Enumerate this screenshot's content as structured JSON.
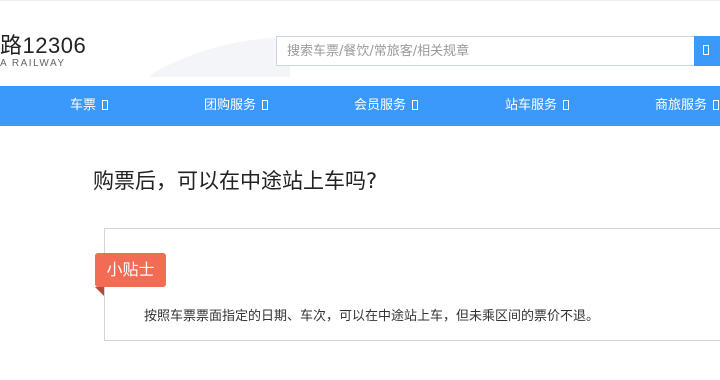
{
  "header": {
    "logo_text": "路12306",
    "logo_subtitle": "A RAILWAY",
    "search": {
      "placeholder": "搜索车票/餐饮/常旅客/相关规章",
      "button_icon": "search-icon"
    }
  },
  "nav": {
    "items": [
      {
        "label": "车票"
      },
      {
        "label": "团购服务"
      },
      {
        "label": "会员服务"
      },
      {
        "label": "站车服务"
      },
      {
        "label": "商旅服务"
      }
    ]
  },
  "content": {
    "question": "购票后，可以在中途站上车吗?",
    "tip": {
      "badge": "小贴士",
      "text": "按照车票票面指定的日期、车次，可以在中途站上车，但未乘区间的票价不退。"
    }
  },
  "colors": {
    "nav_bg": "#3b99fc",
    "badge_bg": "#f26b55"
  }
}
